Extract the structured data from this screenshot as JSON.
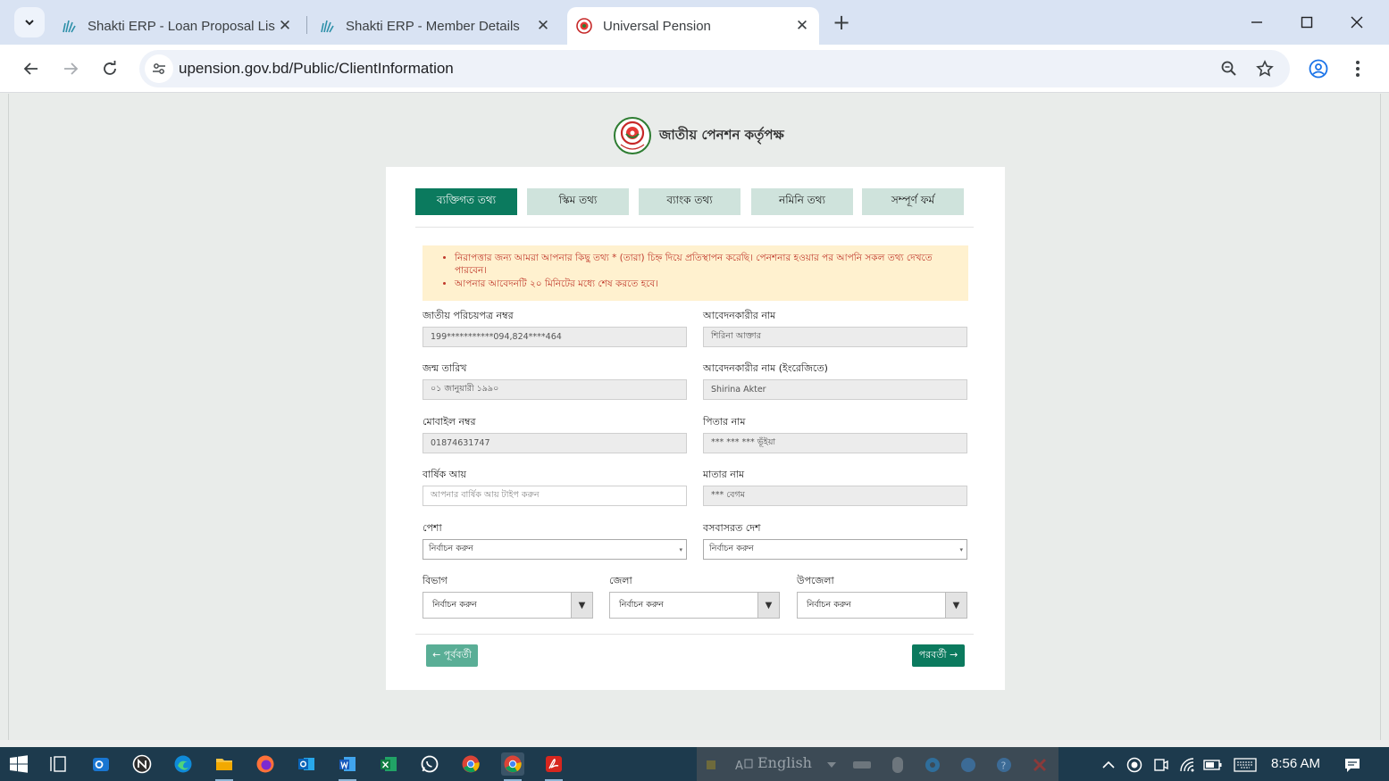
{
  "browser": {
    "tabs": [
      {
        "title": "Shakti ERP - Loan Proposal List",
        "active": false
      },
      {
        "title": "Shakti ERP - Member Details",
        "active": false
      },
      {
        "title": "Universal Pension",
        "active": true
      }
    ],
    "url": "upension.gov.bd/Public/ClientInformation"
  },
  "page": {
    "brand_name": "জাতীয় পেনশন কর্তৃপক্ষ",
    "steps": [
      {
        "label": "ব্যক্তিগত তথ্য",
        "active": true
      },
      {
        "label": "স্কিম তথ্য",
        "active": false
      },
      {
        "label": "ব্যাংক তথ্য",
        "active": false
      },
      {
        "label": "নমিনি তথ্য",
        "active": false
      },
      {
        "label": "সম্পূর্ণ ফর্ম",
        "active": false
      }
    ],
    "notice": [
      "নিরাপত্তার জন্য আমরা আপনার কিছু তথ্য * (তারা) চিহ্ন দিয়ে প্রতিস্থাপন করেছি। পেনশনার হওয়ার পর আপনি সকল তথ্য দেখতে পারবেন।",
      "আপনার আবেদনটি ২০ মিনিটের মধ্যে শেষ করতে হবে।"
    ],
    "fields": {
      "nid": {
        "label": "জাতীয় পরিচয়পত্র নম্বর",
        "value": "199***********094,824****464"
      },
      "applicant_name": {
        "label": "আবেদনকারীর নাম",
        "value": "শিরিনা আক্তার"
      },
      "dob": {
        "label": "জন্ম তারিখ",
        "value": "০১ জানুয়ারী ১৯৯০"
      },
      "applicant_name_en": {
        "label": "আবেদনকারীর নাম (ইংরেজিতে)",
        "value": "Shirina Akter"
      },
      "mobile": {
        "label": "মোবাইল নম্বর",
        "value": "01874631747"
      },
      "father_name": {
        "label": "পিতার নাম",
        "value": "*** *** *** ভূঁইয়া"
      },
      "annual_income": {
        "label": "বার্ষিক আয়",
        "placeholder": "আপনার বার্ষিক আয় টাইপ করুন"
      },
      "mother_name": {
        "label": "মাতার নাম",
        "value": "*** বেগম"
      },
      "occupation": {
        "label": "পেশা",
        "selected": "নির্বাচন করুন"
      },
      "country": {
        "label": "বসবাসরত দেশ",
        "selected": "নির্বাচন করুন"
      },
      "division": {
        "label": "বিভাগ",
        "selected": "নির্বাচন করুন"
      },
      "district": {
        "label": "জেলা",
        "selected": "নির্বাচন করুন"
      },
      "upazila": {
        "label": "উপজেলা",
        "selected": "নির্বাচন করুন"
      }
    },
    "buttons": {
      "prev": "← পূর্ববর্তী",
      "next": "পরবর্তী →"
    }
  },
  "taskbar": {
    "language": "English",
    "clock": "8:56 AM"
  },
  "colors": {
    "primary": "#0b7a5e",
    "step_inactive": "#cfe3dc",
    "notice_bg": "#fff1cf",
    "notice_text": "#c0392b",
    "tabbar": "#d9e3f3",
    "taskbar": "#1d3a4d"
  }
}
